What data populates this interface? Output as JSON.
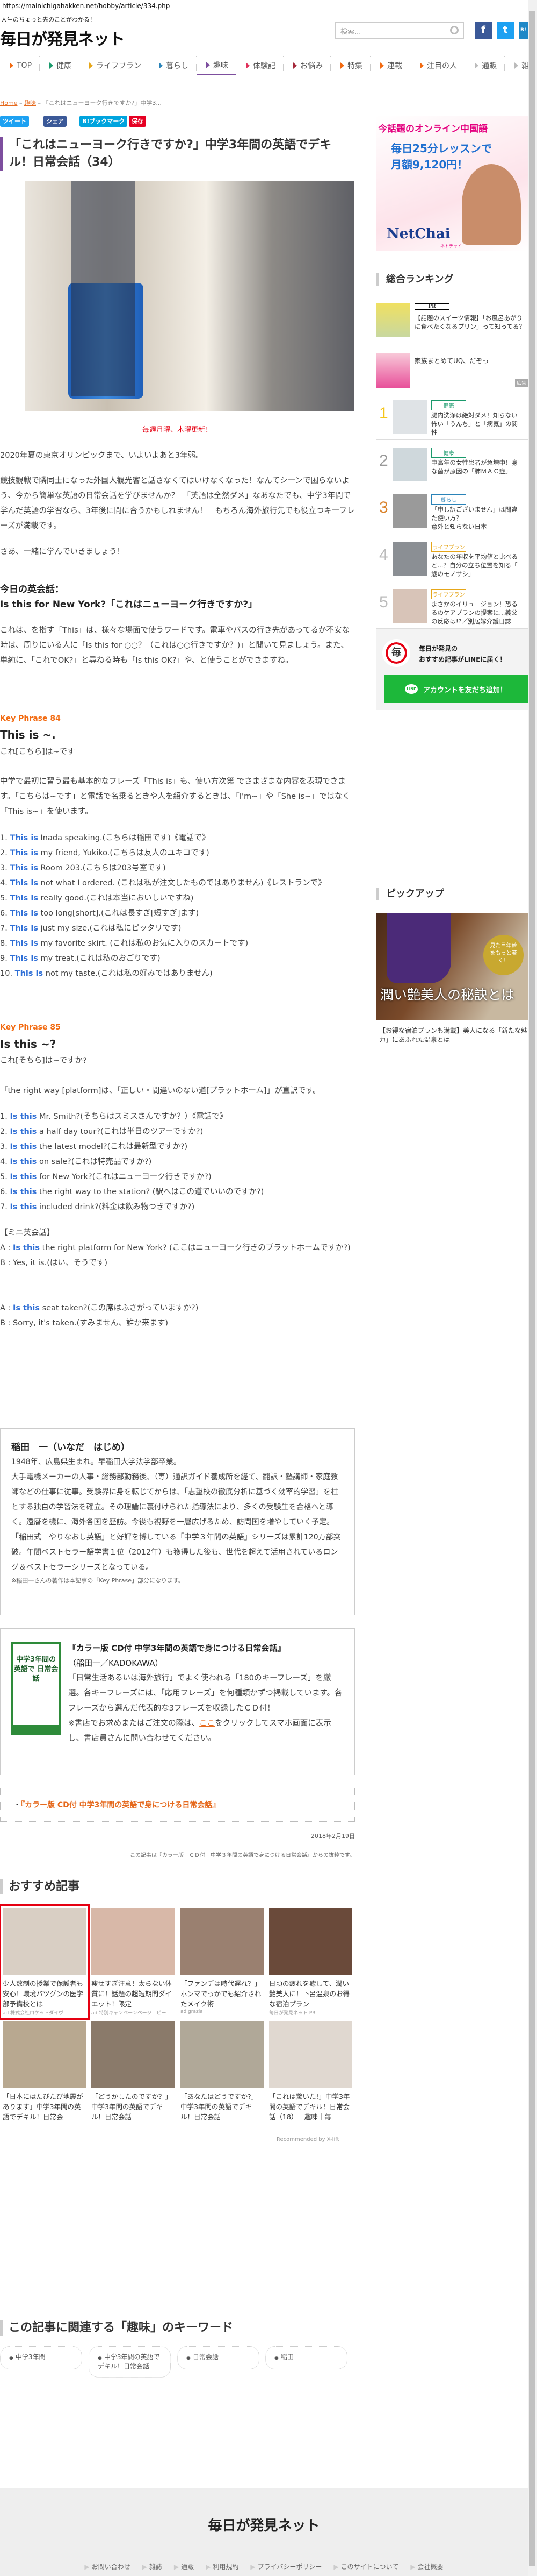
{
  "browser": {
    "url": "https://mainichigahakken.net/hobby/article/334.php"
  },
  "header": {
    "tagline": "人生のちょっと先のことがわかる！",
    "logo": "毎日が発見ネット",
    "search_placeholder": "検索...",
    "social": [
      "f",
      "t",
      "B!"
    ]
  },
  "nav": [
    {
      "label": "TOP",
      "color": "#f26a10"
    },
    {
      "label": "健康",
      "color": "#1a9a6c"
    },
    {
      "label": "ライフプラン",
      "color": "#e6a619"
    },
    {
      "label": "暮らし",
      "color": "#2a83b8"
    },
    {
      "label": "趣味",
      "color": "#7d4e9e",
      "active": true
    },
    {
      "label": "体験記",
      "color": "#e0305a"
    },
    {
      "label": "お悩み",
      "color": "#a4283a"
    },
    {
      "label": "特集",
      "color": "#f26a10"
    },
    {
      "label": "連載",
      "color": "#f26a10"
    },
    {
      "label": "注目の人",
      "color": "#f26a10"
    },
    {
      "label": "通販",
      "color": "#bbbbbb"
    },
    {
      "label": "雑誌",
      "color": "#bbbbbb"
    }
  ],
  "breadcrumb": {
    "home": "Home",
    "category": "趣味",
    "current": "「これはニューヨーク行きですか?」中学3..."
  },
  "share": {
    "tweet": "ツイート",
    "share": "シェア",
    "bookmark": "B!ブックマーク",
    "save": "保存"
  },
  "article": {
    "title": "「これはニューヨーク行きですか?」中学3年間の英語でデキル！日常会話（34）",
    "caption": "毎週月曜、木曜更新！",
    "intro": [
      "2020年夏の東京オリンピックまで、いよいよあと3年弱。",
      "競技観戦で隣同士になった外国人観光客と話さなくてはいけなくなった！なんてシーンで困らないよう、今から簡単な英語の日常会話を学びませんか？　「英語は全然ダメ」なあなたでも、中学3年間で学んだ英語の学習なら、3年後に間に合うかもしれません！　もちろん海外旅行先でも役立つキーフレーズが満載です。",
      "さあ、一緒に学んでいきましょう！"
    ],
    "today_label": "今日の英会話：",
    "today_phrase": "Is this for New York?「これはニューヨーク行きですか?」",
    "today_text": "これは、を指す「This」は、様々な場面で使うワードです。電車やバスの行き先があってるか不安な時は、周りにいる人に「Is this for ○○？（これは○○行きですか？)」と聞いて見ましょう。また、単純に、「これでOK?」と尋ねる時も「Is this OK?」や、と使うことができますね。",
    "kp84": {
      "label": "Key Phrase 84",
      "phrase": "This is ~.",
      "meaning": "これ[こちら]は~です",
      "text": "中学で最初に習う最も基本的なフレーズ「This is」も、使い方次第 でさまざまな内容を表現できます。「こちらは~です」と電話で名乗るときや人を紹介するときは、「I'm~」や「She is~」ではなく「This is~」を使います。",
      "items": [
        {
          "num": "1.",
          "key": "This is",
          "rest": " Inada speaking.(こちらは稲田です)《電話で》"
        },
        {
          "num": "2.",
          "key": "This is",
          "rest": " my friend, Yukiko.(こちらは友人のユキコです)"
        },
        {
          "num": "3.",
          "key": "This is",
          "rest": " Room 203.(こちらは203号室です)"
        },
        {
          "num": "4.",
          "key": "This is",
          "rest": " not what I ordered. (これは私が注文したものではありません)《レストランで》"
        },
        {
          "num": "5.",
          "key": "This is",
          "rest": " really good.(これは本当においしいですね)"
        },
        {
          "num": "6.",
          "key": "This is",
          "rest": " too long[short].(これは長すぎ[短すぎ]ます)"
        },
        {
          "num": "7.",
          "key": "This is",
          "rest": " just my size.(これは私にピッタリです)"
        },
        {
          "num": "8.",
          "key": "This is",
          "rest": " my favorite skirt. (これは私のお気に入りのスカートです)"
        },
        {
          "num": "9.",
          "key": "This is",
          "rest": " my treat.(これは私のおごりです)"
        },
        {
          "num": "10.",
          "key": "This is",
          "rest": " not my taste.(これは私の好みではありません)"
        }
      ]
    },
    "kp85": {
      "label": "Key Phrase 85",
      "phrase": "Is this ~?",
      "meaning": "これ[そちら]は~ですか?",
      "text": "「the right way [platform]は、「正しい・間違いのない道[プラットホーム]」が直訳です。",
      "items": [
        {
          "num": "1.",
          "key": "Is this",
          "rest": " Mr. Smith?(そちらはスミスさんですか？）《電話で》"
        },
        {
          "num": "2.",
          "key": "Is this",
          "rest": " a half day tour?(これは半日のツアーですか?)"
        },
        {
          "num": "3.",
          "key": "Is this",
          "rest": " the latest model?(これは最新型ですか?)"
        },
        {
          "num": "4.",
          "key": "Is this",
          "rest": " on sale?(これは特売品ですか?)"
        },
        {
          "num": "5.",
          "key": "Is this",
          "rest": " for New York?(これはニューヨーク行きですか?)"
        },
        {
          "num": "6.",
          "key": "Is this",
          "rest": " the right way to the station? (駅へはこの道でいいのですか?)"
        },
        {
          "num": "7.",
          "key": "Is this",
          "rest": " included drink?(料金は飲み物つきですか?)"
        }
      ]
    },
    "mini": {
      "heading": "【ミニ英会話】",
      "a1_pre": "A : ",
      "a1_key": "Is this",
      "a1_rest": " the right platform for New York? (ここはニューヨーク行きのプラットホームですか?)",
      "b1": "B : Yes, it is.(はい、そうです)",
      "a2_pre": "A : ",
      "a2_key": "Is this",
      "a2_rest": " seat taken?(この席はふさがっていますか?)",
      "b2": "B : Sorry, it's taken.(すみません、誰か来ます)"
    }
  },
  "author": {
    "name": "稲田　一（いなだ　はじめ）",
    "bio": [
      "1948年、広島県生まれ。早稲田大学法学部卒業。",
      "大手電機メーカーの人事・総務部勤務後、（専）通訳ガイド養成所を経て、翻訳・塾講師・家庭教師などの仕事に従事。受験界に身を転じてからは、「志望校の徹底分析に基づく効率的学習」を柱とする独自の学習法を確立。その理論に裏付けられた指導法により、多くの受験生を合格へと導く。還暦を機に、海外各国を歴訪。今後も視野を一層広げるため、訪問国を増やしていく予定。",
      "「稲田式　やりなおし英語」と好評を博している「中学３年間の英語」シリーズは累計120万部突破。年間ベストセラー語学書１位（2012年）も獲得した後も、世代を超えて活用されているロング＆ベストセラーシリーズとなっている。"
    ],
    "note": "※稲田一さんの著作は本記事の「Key Phrase」部分になります。"
  },
  "book": {
    "cover_text": "中学3年間の英語で 日常会話",
    "title": "『カラー版 CD付 中学3年間の英語で身につける日常会話』",
    "publisher": "（稲田一／KADOKAWA）",
    "desc": "「日常生活あるいは海外旅行」でよく使われる「180のキーフレーズ」を厳選。各キーフレーズには、「応用フレーズ」を何種類かずつ掲載しています。各フレーズから選んだ代表的な3フレーズを収録したＣＤ付！",
    "order_pre": "※書店でお求めまたはご注文の際は、",
    "order_link": "ここ",
    "order_post": "をクリックしてスマホ画面に表示し、書店員さんに問い合わせてください。",
    "link_text": "『カラー版 CD付 中学3年間の英語で身につける日常会話』"
  },
  "meta": {
    "date": "2018年2月19日",
    "source": "この記事は『カラー版　ＣＤ付　中学３年間の英語で身につける日常会話』からの抜粋です。"
  },
  "recommend": {
    "heading": "おすすめ記事",
    "items": [
      {
        "title": "少人数制の授業で保護者も安心！環境バツグンの医学部予備校とは",
        "source": "ad 株式会社ロケットダイヴ",
        "color": "#d9cfc4"
      },
      {
        "title": "痩せすぎ注意！太らない体質に！話題の超短期間ダイエット！限定",
        "source": "ad 特別キャンペーンページ　ビー",
        "color": "#d8b8a8"
      },
      {
        "title": "「ファンデは時代遅れ？」ホンマでっかでも紹介されたメイク術",
        "source": "ad grazia",
        "color": "#9a8070"
      },
      {
        "title": "日頃の疲れを癒して、潤い艶美人に！下呂温泉のお得な宿泊プラン",
        "source": "毎日が発見ネット PR",
        "color": "#6a4a3a"
      },
      {
        "title": "「日本にはたびたび地震があります」中学3年間の英語でデキル！日常会",
        "source": "",
        "color": "#b8a890"
      },
      {
        "title": "「どうかしたのですか？」中学3年間の英語でデキル！日常会話",
        "source": "",
        "color": "#8a7a6a"
      },
      {
        "title": "「あなたはどうですか?」中学3年間の英語でデキル！日常会話",
        "source": "",
        "color": "#b0a898"
      },
      {
        "title": "「これは驚いた!」中学3年間の英語でデキル！日常会話（18）｜趣味｜毎",
        "source": "",
        "color": "#e0d8d0"
      }
    ],
    "credit": "Recommended by X-lift"
  },
  "keywords": {
    "heading": "この記事に関連する「趣味」のキーワード",
    "items": [
      "中学3年間",
      "中学3年間の英語でデキル！日常会話",
      "日常会話",
      "稲田一"
    ]
  },
  "footer": {
    "logo": "毎日が発見ネット",
    "links": [
      "お問い合わせ",
      "雑誌",
      "通販",
      "利用規約",
      "プライバシーポリシー",
      "このサイトについて",
      "会社概要"
    ]
  },
  "sidebar": {
    "ad": {
      "line1": "今話題のオンライン中国語",
      "line2": "毎日25分レッスンで",
      "line3": "月額9,120円！",
      "brand": "NetChai",
      "brand_sub": "ネトチャイ"
    },
    "ranking_heading": "総合ランキング",
    "pr": {
      "badge": "PR",
      "title": "【話題のスイーツ情報】「お風呂あがりに食べたくなるプリン」って知ってる？"
    },
    "uq": {
      "title": "家族まとめてUQ、だぞっ",
      "badge": "広告"
    },
    "ranks": [
      {
        "num": "1",
        "cat": "健康",
        "cat_color": "#1a9a6c",
        "num_color": "#f5c518",
        "title": "腸内洗浄は絶対ダメ！知らない 怖い「うんち」と「病気」の関 性",
        "img": "#dfe3e6"
      },
      {
        "num": "2",
        "cat": "健康",
        "cat_color": "#1a9a6c",
        "num_color": "#999999",
        "title": "中高年の女性患者が急増中！身 な菌が原因の「肺ＭＡＣ症」",
        "img": "#cfd8dc"
      },
      {
        "num": "3",
        "cat": "暮らし",
        "cat_color": "#2a83b8",
        "num_color": "#d9822b",
        "title": "「申し訳ございません」は間違 た使い方？ 意外と知らない日本 語の正しい用法",
        "img": "#9a9a9a"
      },
      {
        "num": "4",
        "cat": "ライフプラン",
        "cat_color": "#e6a619",
        "num_color": "#bbbbbb",
        "title": "あなたの年収を平均値と比べる と...？自分の立ち位置を知る「 歳のモノサシ」",
        "img": "#8b8f94"
      },
      {
        "num": "5",
        "cat": "ライフプラン",
        "cat_color": "#e6a619",
        "num_color": "#bbbbbb",
        "title": "まさかのイリュージョン！恐る るのケアプランの提案に...義父 の反応は!?／別居嫁介護日誌",
        "img": "#d8c4b8"
      }
    ],
    "line": {
      "text1": "毎日が発見の",
      "text2": "おすすめ記事がLINEに届く！",
      "button": "アカウントを友だち追加！",
      "badge": "LINE",
      "logo": "毎"
    },
    "pickup_heading": "ピックアップ",
    "pickup": {
      "overlay": "潤い艶美人の秘訣とは",
      "bubble": "見た目年齢をもっと若く！",
      "caption": "【お得な宿泊プランも満載】美人になる「新たな魅力」にあふれた温泉とは"
    }
  }
}
